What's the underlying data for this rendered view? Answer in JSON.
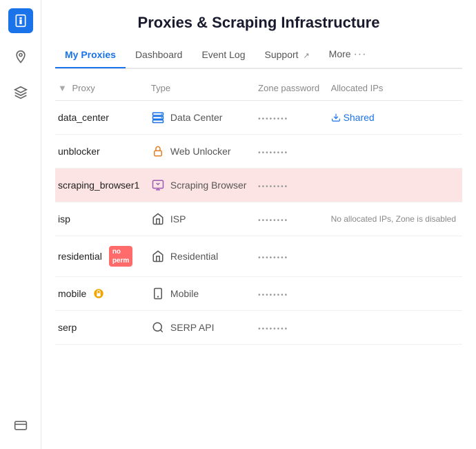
{
  "app": {
    "title": "Proxies & Scraping Infrastructure"
  },
  "nav": {
    "tabs": [
      {
        "id": "my-proxies",
        "label": "My Proxies",
        "active": true,
        "external": false
      },
      {
        "id": "dashboard",
        "label": "Dashboard",
        "active": false,
        "external": false
      },
      {
        "id": "event-log",
        "label": "Event Log",
        "active": false,
        "external": false
      },
      {
        "id": "support",
        "label": "Support",
        "active": false,
        "external": true
      },
      {
        "id": "more",
        "label": "More",
        "active": false,
        "external": false,
        "dots": true
      }
    ]
  },
  "sidebar": {
    "icons": [
      {
        "id": "info",
        "label": "Info",
        "active": true
      },
      {
        "id": "location",
        "label": "Location",
        "active": false
      },
      {
        "id": "layers",
        "label": "Layers",
        "active": false
      },
      {
        "id": "card",
        "label": "Card",
        "active": false
      }
    ]
  },
  "table": {
    "columns": [
      "Proxy",
      "Type",
      "Zone password",
      "Allocated IPs"
    ],
    "rows": [
      {
        "id": "data_center",
        "proxy": "data_center",
        "type": "Data Center",
        "type_icon": "data-center",
        "password": "••••••••",
        "allocated": "Shared",
        "allocated_type": "shared",
        "highlighted": false
      },
      {
        "id": "unblocker",
        "proxy": "unblocker",
        "type": "Web Unlocker",
        "type_icon": "web-unlocker",
        "password": "••••••••",
        "allocated": "",
        "allocated_type": "none",
        "highlighted": false
      },
      {
        "id": "scraping_browser1",
        "proxy": "scraping_browser1",
        "type": "Scraping Browser",
        "type_icon": "scraping-browser",
        "password": "••••••••",
        "allocated": "",
        "allocated_type": "none",
        "highlighted": true
      },
      {
        "id": "isp",
        "proxy": "isp",
        "type": "ISP",
        "type_icon": "isp",
        "password": "••••••••",
        "allocated": "No allocated IPs, Zone is disabled",
        "allocated_type": "disabled",
        "highlighted": false
      },
      {
        "id": "residential",
        "proxy": "residential",
        "type": "Residential",
        "type_icon": "residential",
        "password": "••••••••",
        "allocated": "",
        "allocated_type": "none",
        "highlighted": false,
        "badge": "no perm"
      },
      {
        "id": "mobile",
        "proxy": "mobile",
        "type": "Mobile",
        "type_icon": "mobile",
        "password": "••••••••",
        "allocated": "",
        "allocated_type": "none",
        "highlighted": false,
        "lock": true
      },
      {
        "id": "serp",
        "proxy": "serp",
        "type": "SERP API",
        "type_icon": "serp",
        "password": "••••••••",
        "allocated": "",
        "allocated_type": "none",
        "highlighted": false
      }
    ]
  }
}
